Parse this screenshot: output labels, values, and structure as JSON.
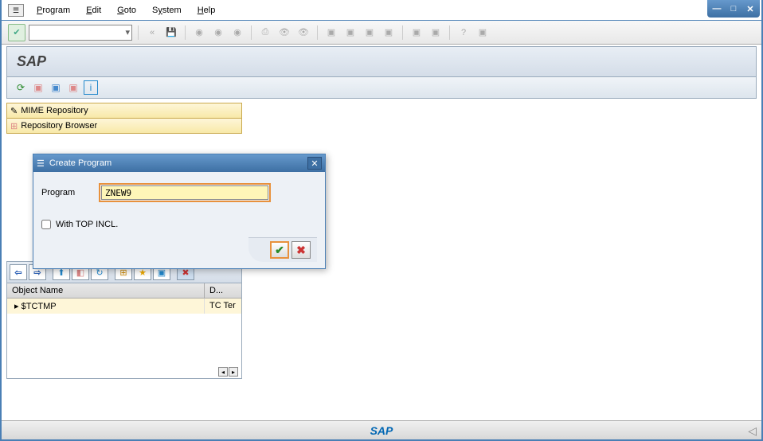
{
  "menubar": {
    "items": [
      "Program",
      "Edit",
      "Goto",
      "System",
      "Help"
    ]
  },
  "app": {
    "title": "SAP",
    "logo": "SAP"
  },
  "panels": {
    "mime": "MIME Repository",
    "repo": "Repository Browser"
  },
  "tree": {
    "col1": "Object Name",
    "col2": "D...",
    "row1_name": "$TCTMP",
    "row1_desc": "TC Ter"
  },
  "dialog": {
    "title": "Create Program",
    "field_label": "Program",
    "field_value": "ZNEW9",
    "checkbox_label": "With TOP INCL."
  }
}
